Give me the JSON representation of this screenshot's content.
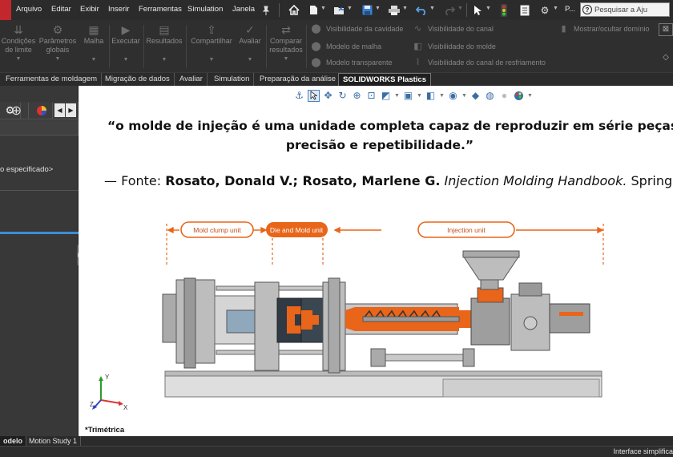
{
  "menu": {
    "items": [
      "Arquivo",
      "Editar",
      "Exibir",
      "Inserir",
      "Ferramentas",
      "Simulation",
      "Janela"
    ],
    "search_placeholder": "Pesquisar a Aju",
    "truncated_label": "P..."
  },
  "commands": {
    "buttons": [
      {
        "label": "Condições de limite"
      },
      {
        "label": "Parâmetros globais"
      },
      {
        "label": "Malha"
      },
      {
        "label": "Executar"
      },
      {
        "label": "Resultados"
      },
      {
        "label": "Compartilhar"
      },
      {
        "label": "Avaliar"
      },
      {
        "label": "Comparar resultados"
      }
    ],
    "visibility": [
      "Visibilidade da cavidade",
      "Modelo de malha",
      "Modelo transparente",
      "Visibilidade do canal",
      "Visibilidade do molde",
      "Visibilidade do canal de resfriamento",
      "Mostrar/ocultar domínio"
    ]
  },
  "tabs": [
    {
      "label": "Ferramentas de moldagem"
    },
    {
      "label": "Migração de dados"
    },
    {
      "label": "Avaliar"
    },
    {
      "label": "Simulation"
    },
    {
      "label": "Preparação da análise"
    },
    {
      "label": "SOLIDWORKS Plastics",
      "active": true
    }
  ],
  "left_panel": {
    "item_text": "o especificado>"
  },
  "graphics": {
    "quote_line1": "“o molde de injeção é uma unidade completa capaz de reproduzir em série peças plástic",
    "quote_line2": "precisão e repetibilidade.”",
    "source_prefix": "— Fonte: ",
    "source_authors": "Rosato, Donald V.; Rosato, Marlene G.",
    "source_title": "Injection Molding Handbook.",
    "source_publisher": " Springer,",
    "view_label": "*Trimétrica",
    "triad": {
      "y": "Y",
      "x": "X",
      "z": "Z"
    }
  },
  "diagram": {
    "labels": [
      "Mold clump unit",
      "Die and Mold unit",
      "Injection unit"
    ],
    "accent_color": "#e8651a"
  },
  "bottom_tabs": [
    {
      "label": "odelo",
      "active": true
    },
    {
      "label": "Motion Study 1"
    }
  ],
  "status": {
    "right_text": "Interface simplifica"
  }
}
